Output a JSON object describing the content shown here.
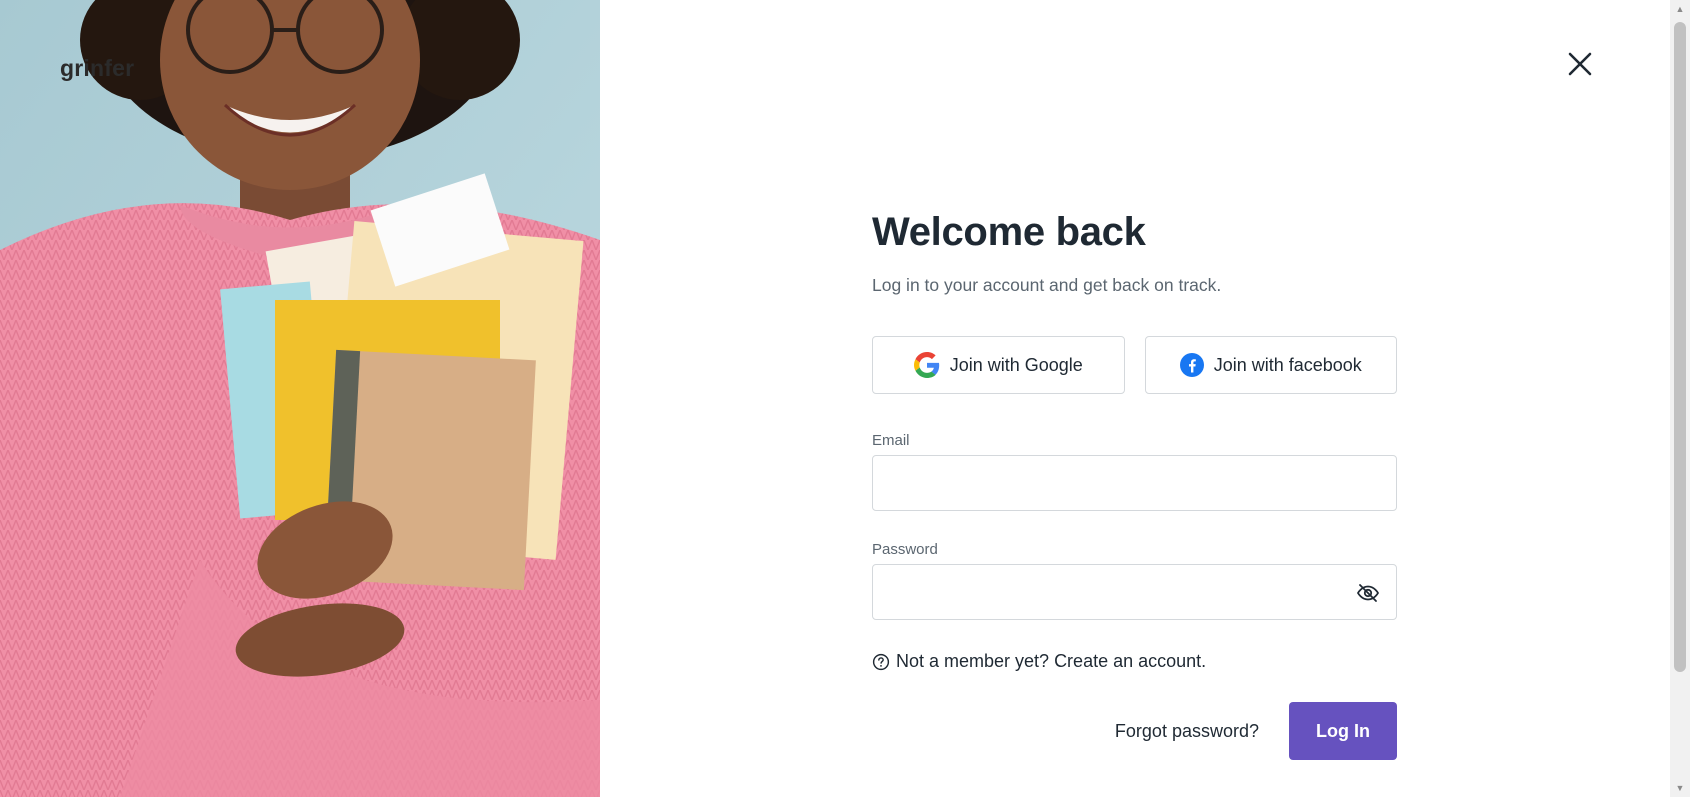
{
  "brand": {
    "logo_text": "grinfer"
  },
  "modal": {
    "close_icon": "close-icon",
    "title": "Welcome back",
    "subtitle": "Log in to your account and get back on track.",
    "social": {
      "google_label": "Join with Google",
      "facebook_label": "Join with facebook"
    },
    "email": {
      "label": "Email",
      "value": "",
      "placeholder": ""
    },
    "password": {
      "label": "Password",
      "value": "",
      "placeholder": "",
      "toggle_icon": "eye-off-icon"
    },
    "signup_prompt": "Not a member yet? Create an account.",
    "forgot_label": "Forgot password?",
    "login_label": "Log In"
  },
  "colors": {
    "primary": "#6652bf",
    "text": "#1f2933",
    "muted": "#5b6670",
    "border": "#d4d8dc",
    "facebook": "#1877f2"
  }
}
